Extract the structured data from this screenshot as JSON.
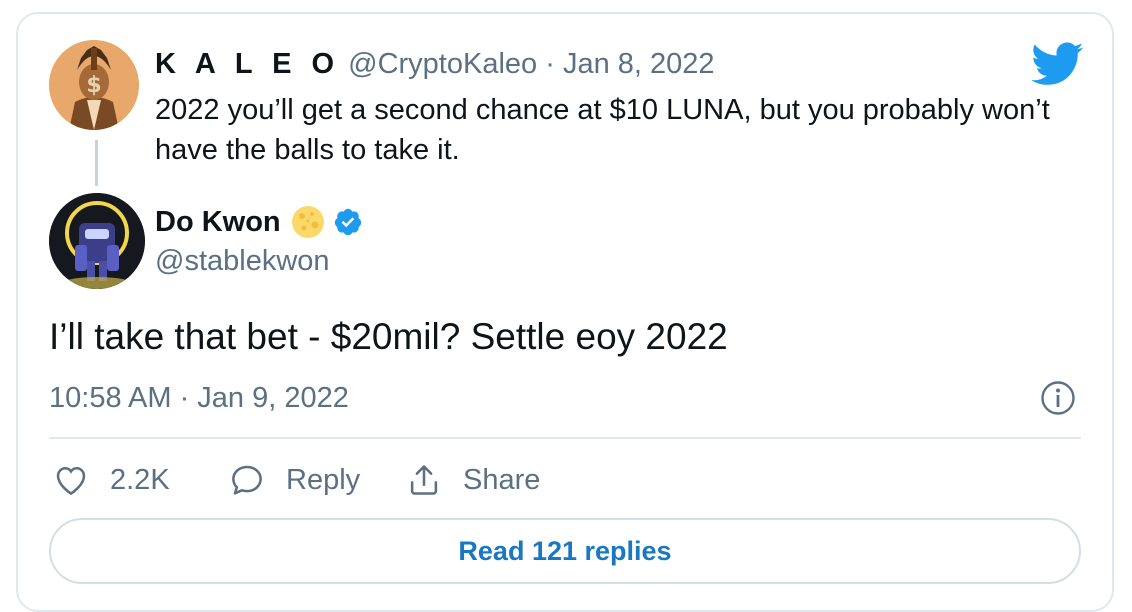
{
  "quoted_tweet": {
    "author_name": "K A L E O",
    "author_handle": "@CryptoKaleo",
    "separator": " · ",
    "date": "Jan 8, 2022",
    "text": "2022 you’ll get a second chance at $10 LUNA, but you probably won’t have the balls to take it."
  },
  "tweet": {
    "author_name": "Do Kwon",
    "author_handle": "@stablekwon",
    "text": "I’ll take that bet - $20mil? Settle eoy 2022",
    "timestamp": "10:58 AM · Jan 9, 2022"
  },
  "actions": {
    "like_count": "2.2K",
    "reply_label": "Reply",
    "share_label": "Share"
  },
  "footer": {
    "read_replies_label": "Read 121 replies"
  },
  "colors": {
    "brand": "#1d9bf0",
    "link": "#1a78c2",
    "secondary_text": "#5b7083",
    "primary_text": "#0f1419"
  },
  "icons": [
    "twitter-bird-icon",
    "moon-emoji-icon",
    "verified-badge-icon",
    "info-icon",
    "heart-icon",
    "reply-bubble-icon",
    "share-icon"
  ]
}
